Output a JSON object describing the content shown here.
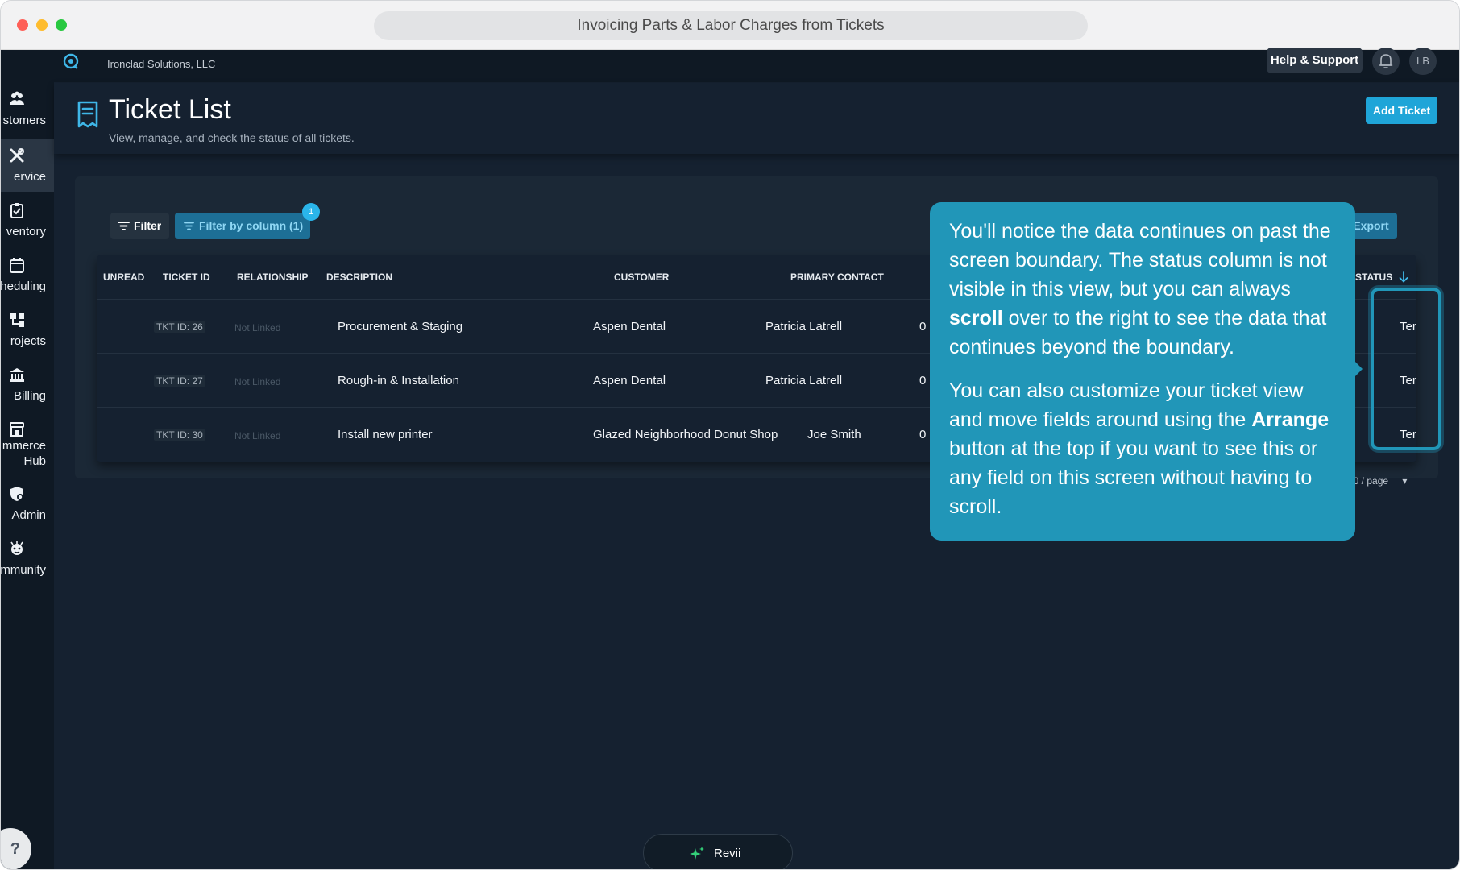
{
  "browser": {
    "title": "Invoicing Parts & Labor Charges from Tickets"
  },
  "topbar": {
    "company": "Ironclad Solutions, LLC",
    "help_label": "Help & Support",
    "avatar_initials": "LB"
  },
  "sidebar": {
    "items": [
      {
        "label": "stomers",
        "icon": "customers-icon",
        "active": false
      },
      {
        "label": "ervice",
        "icon": "service-tools-icon",
        "active": true
      },
      {
        "label": "ventory",
        "icon": "inventory-clipboard-icon",
        "active": false
      },
      {
        "label": "heduling",
        "icon": "calendar-icon",
        "active": false
      },
      {
        "label": "rojects",
        "icon": "projects-icon",
        "active": false
      },
      {
        "label": "Billing",
        "icon": "bank-icon",
        "active": false
      },
      {
        "label_line1": "mmerce",
        "label_line2": "Hub",
        "icon": "store-icon",
        "active": false
      },
      {
        "label": "Admin",
        "icon": "admin-shield-icon",
        "active": false
      },
      {
        "label": "mmunity",
        "icon": "community-icon",
        "active": false
      }
    ],
    "help_glyph": "?"
  },
  "header": {
    "title": "Ticket List",
    "subtitle": "View, manage, and check the status of all tickets.",
    "add_button": "Add Ticket"
  },
  "toolbar": {
    "filter_label": "Filter",
    "filter_column_label": "Filter by column (1)",
    "filter_badge": "1",
    "export_label": "Export"
  },
  "table": {
    "columns": [
      "UNREAD",
      "TICKET ID",
      "RELATIONSHIP",
      "DESCRIPTION",
      "CUSTOMER",
      "PRIMARY CONTACT",
      "STATUS"
    ],
    "rows": [
      {
        "ticket_id": "TKT ID: 26",
        "relationship": "Not Linked",
        "description": "Procurement & Staging",
        "customer": "Aspen Dental",
        "contact": "Patricia Latrell",
        "num": "0",
        "status": "Ter"
      },
      {
        "ticket_id": "TKT ID: 27",
        "relationship": "Not Linked",
        "description": "Rough-in & Installation",
        "customer": "Aspen Dental",
        "contact": "Patricia Latrell",
        "num": "0",
        "status": "Ter"
      },
      {
        "ticket_id": "TKT ID: 30",
        "relationship": "Not Linked",
        "description": "Install new printer",
        "customer": "Glazed Neighborhood Donut Shop",
        "contact": "Joe Smith",
        "num": "0",
        "status": "Ter"
      }
    ],
    "page_size": "10 / page"
  },
  "tooltip": {
    "p1_before": "You'll notice the data continues on past the screen boundary. The status column is not visible in this view, but you can always ",
    "p1_bold": "scroll",
    "p1_after": " over to the right to see the data that continues beyond the boundary.",
    "p2_before": "You can also customize your ticket view and move fields around using the ",
    "p2_bold": "Arrange",
    "p2_after": " button at the top if you want to see this or any field on this screen without having to scroll."
  },
  "assistant": {
    "label": "Revii"
  },
  "colors": {
    "accent": "#1fa5d8",
    "tooltip_bg": "#2196b8",
    "app_bg": "#152130",
    "sidebar_bg": "#0f1924"
  }
}
